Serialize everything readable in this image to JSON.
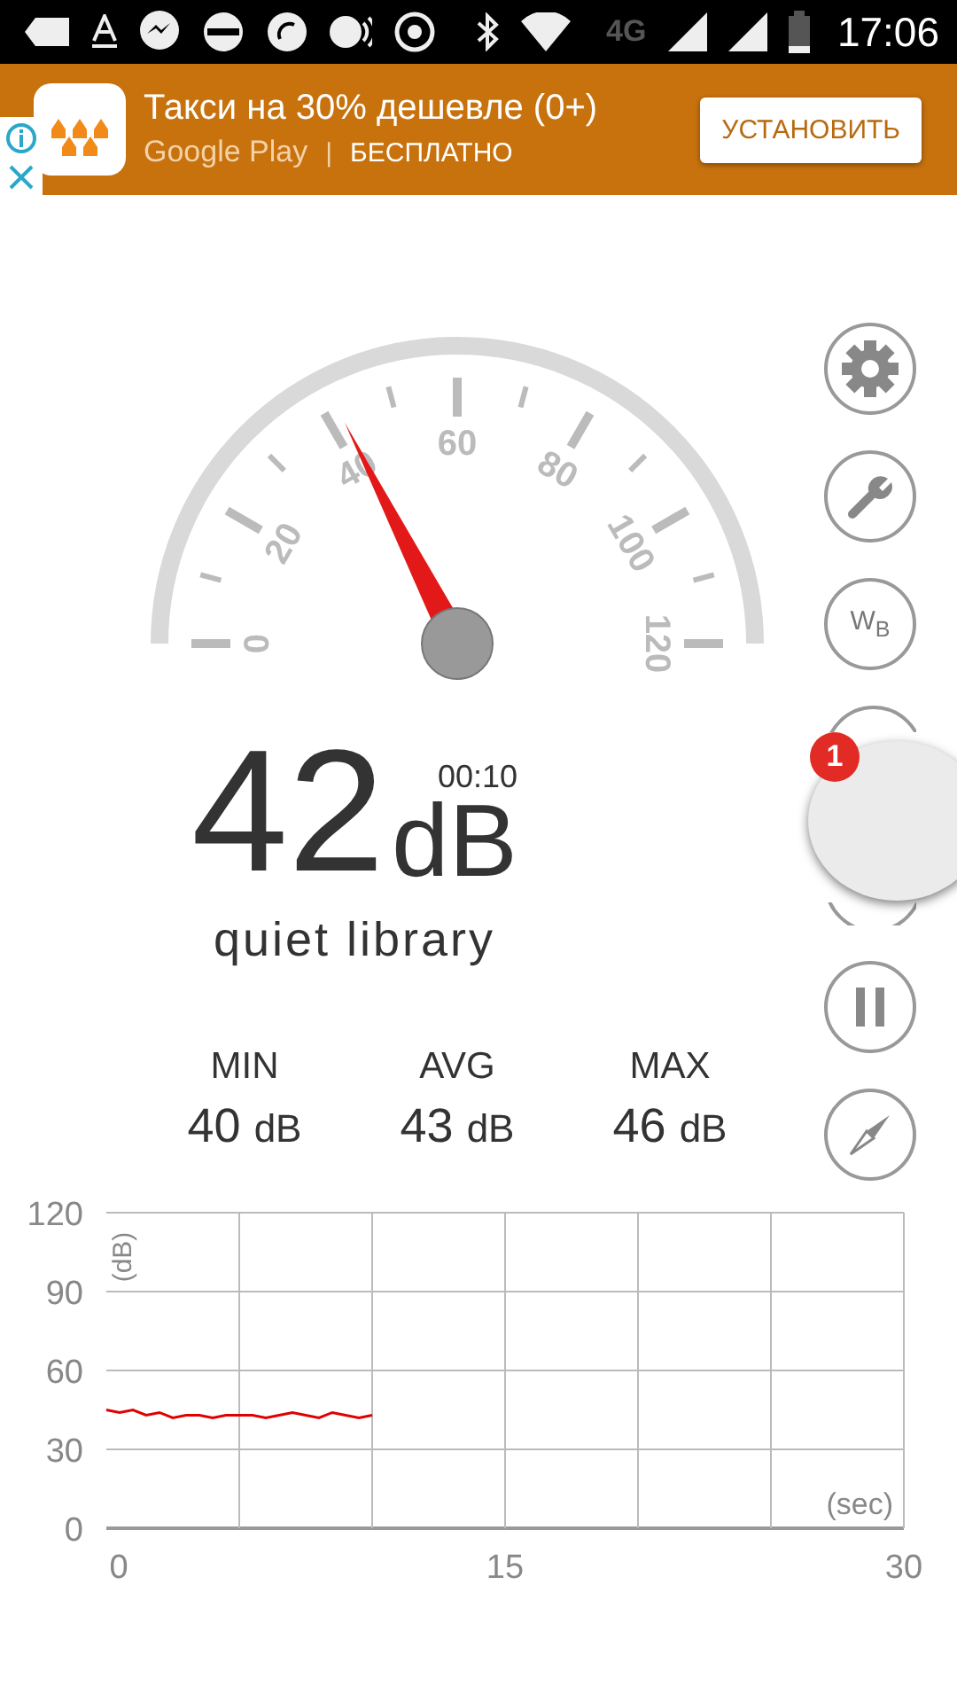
{
  "status_bar": {
    "network": "4G",
    "time": "17:06"
  },
  "ad": {
    "title": "Такси на 30% дешевле (0+)",
    "store": "Google Play",
    "separator": "|",
    "price": "БЕСПЛАТНО",
    "button": "УСТАНОВИТЬ"
  },
  "gauge": {
    "labels": [
      "0",
      "20",
      "40",
      "60",
      "80",
      "100",
      "120"
    ]
  },
  "reading": {
    "value": "42",
    "unit": "dB",
    "timer": "00:10",
    "description": "quiet library"
  },
  "stats": [
    {
      "label": "MIN",
      "value": "40",
      "unit": "dB"
    },
    {
      "label": "AVG",
      "value": "43",
      "unit": "dB"
    },
    {
      "label": "MAX",
      "value": "46",
      "unit": "dB"
    }
  ],
  "side_buttons": [
    {
      "kind": "settings"
    },
    {
      "kind": "tools"
    },
    {
      "kind": "wb",
      "label": "W",
      "sublabel": "B"
    },
    {
      "kind": "partial_top"
    },
    {
      "kind": "partial_bottom"
    },
    {
      "kind": "pause"
    },
    {
      "kind": "compass"
    }
  ],
  "floating_bubble": {
    "badge": "1"
  },
  "chart": {
    "chart_data": {
      "type": "line",
      "xlabel": "(sec)",
      "ylabel": "(dB)",
      "xlim": [
        0,
        30
      ],
      "ylim": [
        0,
        120
      ],
      "xticks": [
        0,
        15,
        30
      ],
      "grid": true,
      "yticks": [
        0,
        30,
        60,
        90,
        120
      ],
      "x": [
        0,
        0.5,
        1,
        1.5,
        2,
        2.5,
        3,
        3.5,
        4,
        4.5,
        5,
        5.5,
        6,
        6.5,
        7,
        7.5,
        8,
        8.5,
        9,
        9.5,
        10
      ],
      "series": [
        {
          "color": "#e00000",
          "values": [
            45,
            44,
            45,
            43,
            44,
            42,
            43,
            43,
            42,
            43,
            43,
            43,
            42,
            43,
            44,
            43,
            42,
            44,
            43,
            42,
            43
          ]
        }
      ]
    }
  }
}
